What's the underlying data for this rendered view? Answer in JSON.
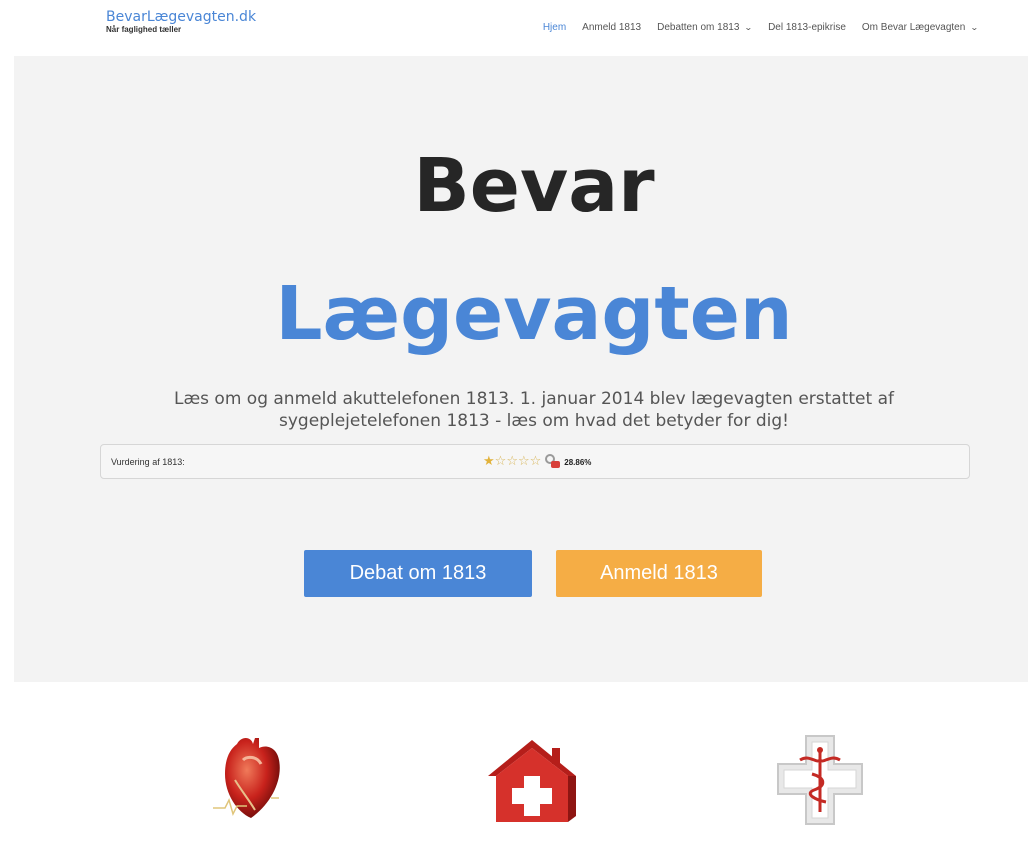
{
  "header": {
    "brand_name": "BevarLægevagten.dk",
    "brand_tagline": "Når faglighed tæller",
    "nav": [
      {
        "label": "Hjem",
        "active": true,
        "has_dropdown": false
      },
      {
        "label": "Anmeld 1813",
        "active": false,
        "has_dropdown": false
      },
      {
        "label": "Debatten om 1813",
        "active": false,
        "has_dropdown": true
      },
      {
        "label": "Del 1813-epikrise",
        "active": false,
        "has_dropdown": false
      },
      {
        "label": "Om Bevar Lægevagten",
        "active": false,
        "has_dropdown": true
      }
    ]
  },
  "hero": {
    "title_line1": "Bevar",
    "title_line2": "Lægevagten",
    "lead": "Læs om og anmeld akuttelefonen 1813. 1. januar 2014 blev lægevagten erstattet af sygeplejetelefonen 1813 - læs om hvad det betyder for dig!",
    "rating": {
      "label": "Vurdering af 1813:",
      "stars_total": 5,
      "stars_filled": 1,
      "percent": "28.86%"
    },
    "buttons": {
      "debat": "Debat om 1813",
      "anmeld": "Anmeld 1813"
    }
  },
  "colors": {
    "accent_blue": "#4a86d6",
    "accent_orange": "#f5ad45",
    "hero_bg": "#f3f3f3"
  },
  "icons": [
    "heart-icon",
    "house-icon",
    "medical-cross-icon"
  ]
}
